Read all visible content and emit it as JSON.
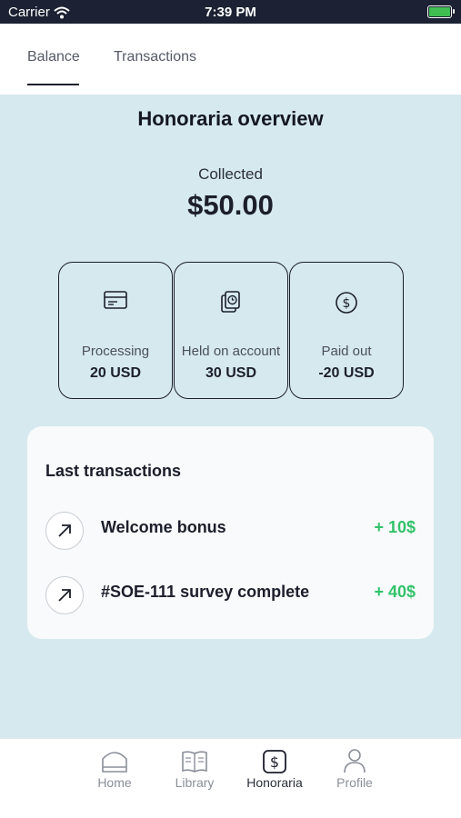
{
  "status_bar": {
    "carrier": "Carrier",
    "time": "7:39 PM"
  },
  "tabs": [
    {
      "label": "Balance",
      "active": true
    },
    {
      "label": "Transactions",
      "active": false
    }
  ],
  "overview": {
    "title": "Honoraria overview",
    "collected_label": "Collected",
    "collected_amount": "$50.00"
  },
  "stats": [
    {
      "icon": "card-icon",
      "label": "Processing",
      "value": "20 USD"
    },
    {
      "icon": "documents-clock-icon",
      "label": "Held on account",
      "value": "30 USD"
    },
    {
      "icon": "dollar-coin-icon",
      "label": "Paid out",
      "value": "-20 USD"
    }
  ],
  "last_transactions": {
    "heading": "Last transactions",
    "items": [
      {
        "icon": "arrow-up-right-icon",
        "name": "Welcome bonus",
        "amount": "+ 10$"
      },
      {
        "icon": "arrow-up-right-icon",
        "name": "#SOE-111 survey complete",
        "amount": "+ 40$"
      }
    ]
  },
  "bottom_nav": [
    {
      "icon": "home-icon",
      "label": "Home",
      "active": false
    },
    {
      "icon": "library-icon",
      "label": "Library",
      "active": false
    },
    {
      "icon": "dollar-icon",
      "label": "Honoraria",
      "active": true
    },
    {
      "icon": "profile-icon",
      "label": "Profile",
      "active": false
    }
  ],
  "colors": {
    "accent_positive": "#32c26a",
    "background": "#d6e9ef",
    "status_bar": "#1c2233"
  }
}
